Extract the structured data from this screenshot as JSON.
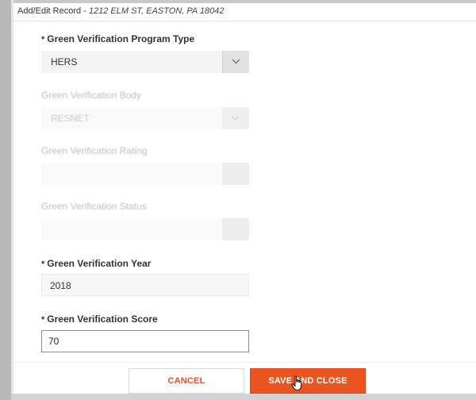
{
  "dialog": {
    "title_prefix": "Add/Edit Record - ",
    "title_address": "1212 ELM ST, EASTON, PA 18042"
  },
  "fields": {
    "program_type": {
      "required_mark": "*",
      "label": "Green Verification Program Type",
      "value": "HERS"
    },
    "body": {
      "label": "Green Verification Body",
      "value": "RESNET"
    },
    "rating": {
      "label": "Green Verification Rating",
      "value": ""
    },
    "status": {
      "label": "Green Verification Status",
      "value": ""
    },
    "year": {
      "required_mark": "*",
      "label": "Green Verification Year",
      "value": "2018"
    },
    "score": {
      "required_mark": "*",
      "label": "Green Verification Score",
      "value": "70"
    }
  },
  "buttons": {
    "cancel": "CANCEL",
    "save_close": "SAVE AND CLOSE"
  },
  "icons": {
    "dropdown": "chevron-down-icon",
    "cursor": "hand-pointer-icon"
  },
  "colors": {
    "accent": "#e9541f",
    "cancel_text": "#e2522a"
  }
}
